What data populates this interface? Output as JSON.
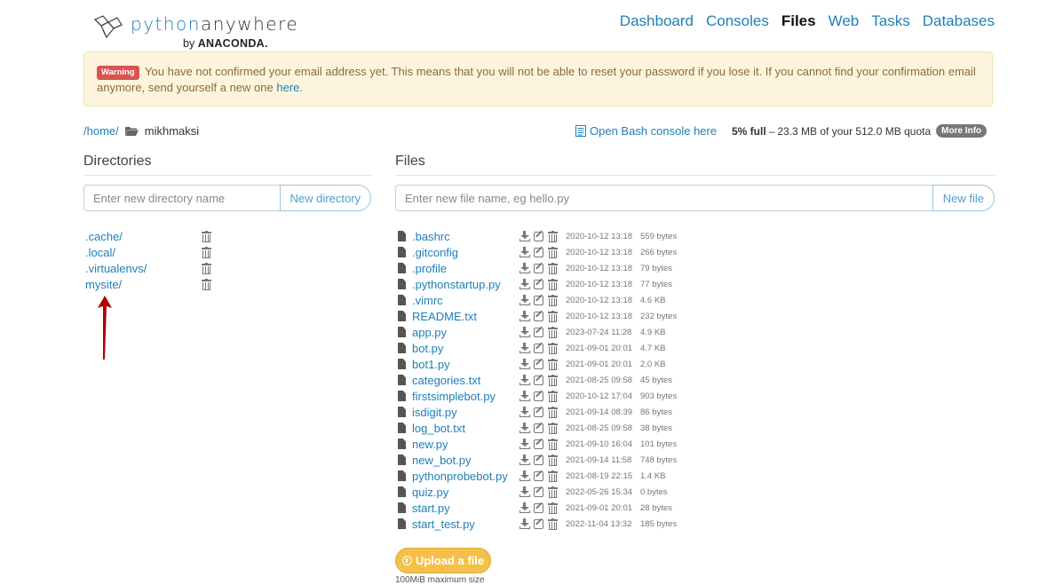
{
  "brand": {
    "name_part1": "python",
    "name_part2": "anywhere",
    "by": "by",
    "company": "ANACONDA."
  },
  "nav": [
    {
      "label": "Dashboard",
      "active": false
    },
    {
      "label": "Consoles",
      "active": false
    },
    {
      "label": "Files",
      "active": true
    },
    {
      "label": "Web",
      "active": false
    },
    {
      "label": "Tasks",
      "active": false
    },
    {
      "label": "Databases",
      "active": false
    }
  ],
  "warning": {
    "badge": "Warning",
    "text": "You have not confirmed your email address yet. This means that you will not be able to reset your password if you lose it. If you cannot find your confirmation email anymore, send yourself a new one",
    "link": "here",
    "end": "."
  },
  "path": {
    "home": "/home/",
    "user": "mikhmaksi"
  },
  "bash_link": "Open Bash console here",
  "quota": {
    "percent": "5% full",
    "dash": "–",
    "used": "23.3 MB of your 512.0 MB quota",
    "more_info": "More Info"
  },
  "directories": {
    "title": "Directories",
    "placeholder": "Enter new directory name",
    "button": "New directory",
    "items": [
      ".cache/",
      ".local/",
      ".virtualenvs/",
      "mysite/"
    ]
  },
  "files": {
    "title": "Files",
    "placeholder": "Enter new file name, eg hello.py",
    "button": "New file",
    "items": [
      {
        "name": ".bashrc",
        "date": "2020-10-12 13:18",
        "size": "559 bytes"
      },
      {
        "name": ".gitconfig",
        "date": "2020-10-12 13:18",
        "size": "266 bytes"
      },
      {
        "name": ".profile",
        "date": "2020-10-12 13:18",
        "size": "79 bytes"
      },
      {
        "name": ".pythonstartup.py",
        "date": "2020-10-12 13:18",
        "size": "77 bytes"
      },
      {
        "name": ".vimrc",
        "date": "2020-10-12 13:18",
        "size": "4.6 KB"
      },
      {
        "name": "README.txt",
        "date": "2020-10-12 13:18",
        "size": "232 bytes"
      },
      {
        "name": "app.py",
        "date": "2023-07-24 11:28",
        "size": "4.9 KB"
      },
      {
        "name": "bot.py",
        "date": "2021-09-01 20:01",
        "size": "4.7 KB"
      },
      {
        "name": "bot1.py",
        "date": "2021-09-01 20:01",
        "size": "2.0 KB"
      },
      {
        "name": "categories.txt",
        "date": "2021-08-25 09:58",
        "size": "45 bytes"
      },
      {
        "name": "firstsimplebot.py",
        "date": "2020-10-12 17:04",
        "size": "903 bytes"
      },
      {
        "name": "isdigit.py",
        "date": "2021-09-14 08:39",
        "size": "86 bytes"
      },
      {
        "name": "log_bot.txt",
        "date": "2021-08-25 09:58",
        "size": "38 bytes"
      },
      {
        "name": "new.py",
        "date": "2021-09-10 16:04",
        "size": "101 bytes"
      },
      {
        "name": "new_bot.py",
        "date": "2021-09-14 11:58",
        "size": "748 bytes"
      },
      {
        "name": "pythonprobebot.py",
        "date": "2021-08-19 22:15",
        "size": "1.4 KB"
      },
      {
        "name": "quiz.py",
        "date": "2022-05-26 15:34",
        "size": "0 bytes"
      },
      {
        "name": "start.py",
        "date": "2021-09-01 20:01",
        "size": "28 bytes"
      },
      {
        "name": "start_test.py",
        "date": "2022-11-04 13:32",
        "size": "185 bytes"
      }
    ],
    "upload_button": "Upload a file",
    "upload_note": "100MiB maximum size"
  },
  "icons": {
    "logo": "pythonanywhere-logo-icon",
    "folder": "folder-open-icon",
    "console": "console-icon",
    "file": "file-icon",
    "download": "download-icon",
    "edit": "edit-icon",
    "delete": "trash-icon",
    "upload": "upload-circle-icon",
    "annotation": "red-arrow-icon"
  },
  "colors": {
    "link": "#1f7fb6",
    "warning_bg": "#fcf4dd",
    "warning_badge": "#d9534f",
    "upload_button": "#f4c04a",
    "arrow": "#b00000"
  }
}
